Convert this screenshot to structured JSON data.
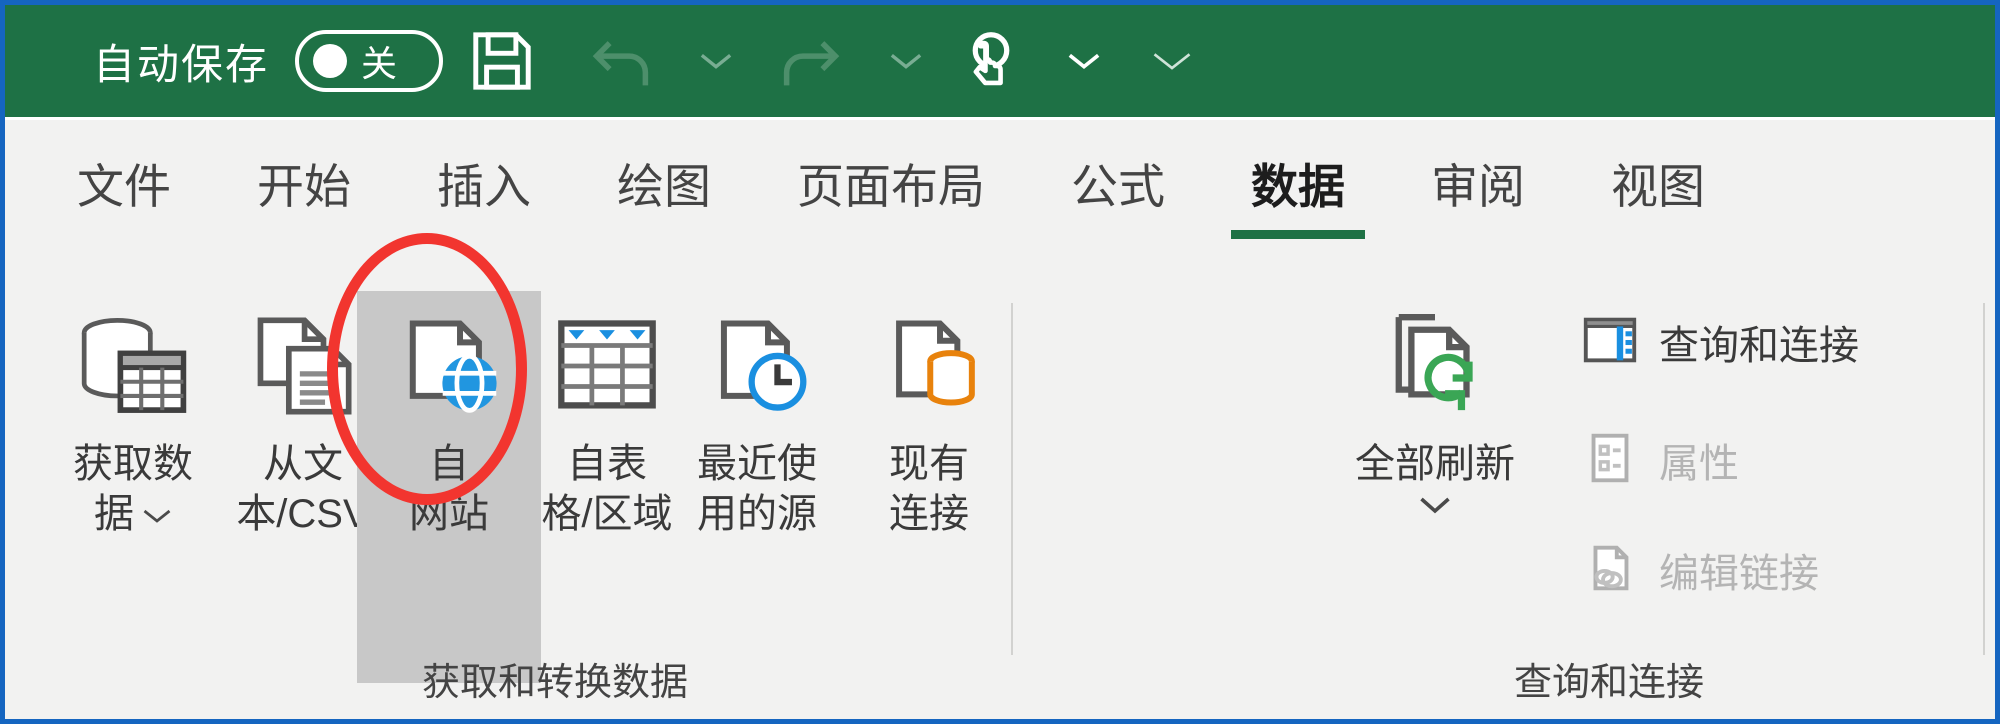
{
  "titlebar": {
    "autosave_label": "自动保存",
    "autosave_state": "关",
    "icons": {
      "save": "save-icon",
      "undo": "undo-icon",
      "undo_chevron": "chevron-down-icon",
      "redo": "redo-icon",
      "redo_chevron": "chevron-down-icon",
      "touch_mode": "touch-pen-mode-icon",
      "touch_chevron": "chevron-down-icon",
      "more_chevron": "chevron-down-icon"
    }
  },
  "tabs": [
    {
      "label": "文件",
      "active": false
    },
    {
      "label": "开始",
      "active": false
    },
    {
      "label": "插入",
      "active": false
    },
    {
      "label": "绘图",
      "active": false
    },
    {
      "label": "页面布局",
      "active": false
    },
    {
      "label": "公式",
      "active": false
    },
    {
      "label": "数据",
      "active": true
    },
    {
      "label": "审阅",
      "active": false
    },
    {
      "label": "视图",
      "active": false
    }
  ],
  "ribbon": {
    "groups": [
      {
        "label": "获取和转换数据"
      },
      {
        "label": "查询和连接"
      }
    ],
    "get_transform_buttons": [
      {
        "label": "获取数\n据",
        "icon": "database-table-icon",
        "has_dropdown": true,
        "highlighted": false
      },
      {
        "label": "从文\n本/CSV",
        "icon": "text-csv-file-icon",
        "has_dropdown": false,
        "highlighted": false
      },
      {
        "label": "自\n网站",
        "icon": "web-globe-file-icon",
        "has_dropdown": false,
        "highlighted": true
      },
      {
        "label": "自表\n格/区域",
        "icon": "table-range-icon",
        "has_dropdown": false,
        "highlighted": false
      },
      {
        "label": "最近使\n用的源",
        "icon": "recent-sources-clock-icon",
        "has_dropdown": false,
        "highlighted": false
      },
      {
        "label": "现有\n连接",
        "icon": "existing-connections-icon",
        "has_dropdown": false,
        "highlighted": false
      }
    ],
    "queries_buttons": [
      {
        "label": "全部刷新",
        "icon": "refresh-all-icon",
        "has_dropdown": true
      }
    ],
    "queries_small_buttons": [
      {
        "label": "查询和连接",
        "icon": "queries-pane-icon",
        "disabled": false
      },
      {
        "label": "属性",
        "icon": "properties-icon",
        "disabled": true
      },
      {
        "label": "编辑链接",
        "icon": "edit-links-icon",
        "disabled": true
      }
    ]
  },
  "annotation": {
    "type": "red-ellipse-highlight",
    "targets": "自网站",
    "color": "#f2352f"
  },
  "colors": {
    "titlebar_green": "#1e7145",
    "ribbon_bg": "#f2f2f1",
    "accent_green": "#1e7145",
    "window_border_blue": "#1565c0",
    "highlight_gray": "#c8c8c8",
    "annotation_red": "#f2352f",
    "globe_blue": "#2196e0",
    "cylinder_orange": "#e8820c",
    "refresh_green": "#3aa655",
    "disabled_gray": "#b4b4b4"
  }
}
